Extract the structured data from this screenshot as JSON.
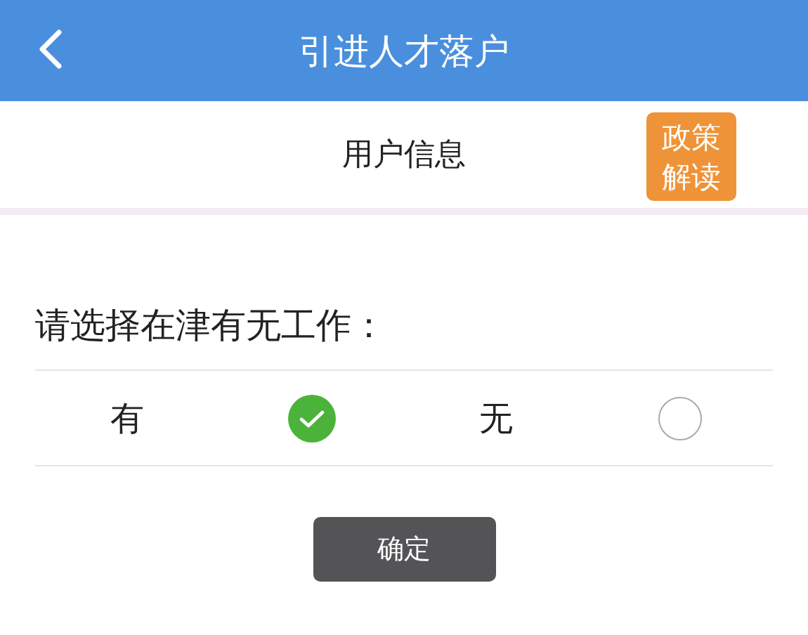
{
  "header": {
    "title": "引进人才落户"
  },
  "subheader": {
    "title": "用户信息",
    "policy_button": "政策解读"
  },
  "question": "请选择在津有无工作：",
  "options": [
    {
      "label": "有",
      "selected": true
    },
    {
      "label": "无",
      "selected": false
    }
  ],
  "confirm_button": "确定"
}
